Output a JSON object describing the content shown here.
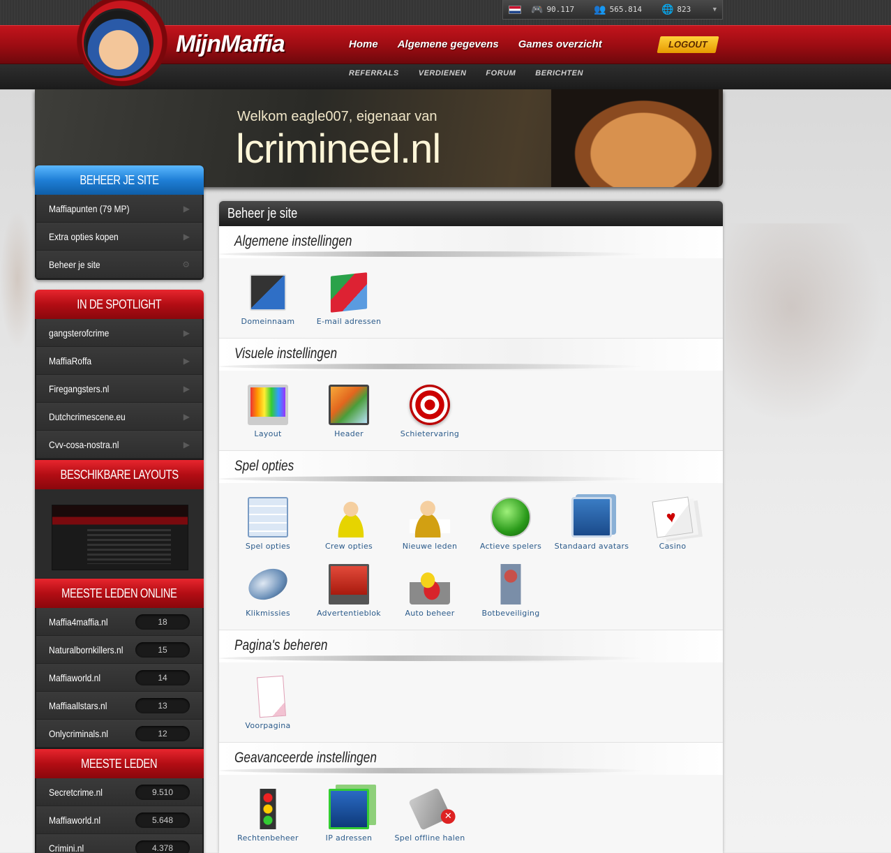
{
  "stats": {
    "games": "90.117",
    "users": "565.814",
    "sites": "823"
  },
  "brand": {
    "name": "MijnMaffia"
  },
  "nav": {
    "main": [
      "Home",
      "Algemene gegevens",
      "Games overzicht"
    ],
    "sub": [
      "REFERRALS",
      "VERDIENEN",
      "FORUM",
      "BERICHTEN"
    ],
    "logout": "LOGOUT"
  },
  "banner": {
    "welcome": "Welkom eagle007, eigenaar van",
    "site": "lcrimineel.nl"
  },
  "sidebar": {
    "beheer": {
      "title": "BEHEER JE SITE",
      "items": [
        "Maffiapunten (79 MP)",
        "Extra opties kopen",
        "Beheer je site"
      ]
    },
    "spotlight": {
      "title": "IN DE SPOTLIGHT",
      "items": [
        "gangsterofcrime",
        "MaffiaRoffa",
        "Firegangsters.nl",
        "Dutchcrimescene.eu",
        "Cvv-cosa-nostra.nl"
      ]
    },
    "layouts": {
      "title": "BESCHIKBARE LAYOUTS"
    },
    "online": {
      "title": "MEESTE LEDEN ONLINE",
      "items": [
        {
          "name": "Maffia4maffia.nl",
          "count": "18"
        },
        {
          "name": "Naturalbornkillers.nl",
          "count": "15"
        },
        {
          "name": "Maffiaworld.nl",
          "count": "14"
        },
        {
          "name": "Maffiaallstars.nl",
          "count": "13"
        },
        {
          "name": "Onlycriminals.nl",
          "count": "12"
        }
      ]
    },
    "members": {
      "title": "MEESTE LEDEN",
      "items": [
        {
          "name": "Secretcrime.nl",
          "count": "9.510"
        },
        {
          "name": "Maffiaworld.nl",
          "count": "5.648"
        },
        {
          "name": "Crimini.nl",
          "count": "4.378"
        }
      ]
    }
  },
  "panel": {
    "title": "Beheer je site",
    "sections": [
      {
        "title": "Algemene instellingen",
        "items": [
          "Domeinnaam",
          "E-mail adressen"
        ]
      },
      {
        "title": "Visuele instellingen",
        "items": [
          "Layout",
          "Header",
          "Schietervaring"
        ]
      },
      {
        "title": "Spel opties",
        "items": [
          "Spel opties",
          "Crew opties",
          "Nieuwe leden",
          "Actieve spelers",
          "Standaard avatars",
          "Casino",
          "Klikmissies",
          "Advertentieblok",
          "Auto beheer",
          "Botbeveiliging"
        ]
      },
      {
        "title": "Pagina's beheren",
        "items": [
          "Voorpagina"
        ]
      },
      {
        "title": "Geavanceerde instellingen",
        "items": [
          "Rechtenbeheer",
          "IP adressen",
          "Spel offline halen"
        ]
      }
    ]
  }
}
